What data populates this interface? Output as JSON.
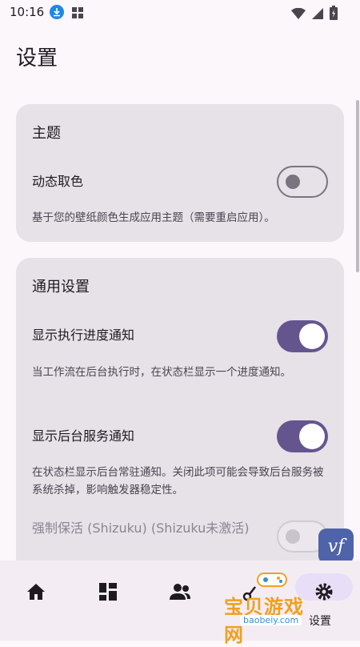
{
  "status": {
    "time": "10:16"
  },
  "page": {
    "title": "设置"
  },
  "theme_card": {
    "title": "主题",
    "dynamic_color_label": "动态取色",
    "dynamic_color_desc": "基于您的壁纸颜色生成应用主题（需要重启应用）。",
    "dynamic_color_on": false
  },
  "general_card": {
    "title": "通用设置",
    "progress_notify_label": "显示执行进度通知",
    "progress_notify_desc": "当工作流在后台执行时，在状态栏显示一个进度通知。",
    "progress_notify_on": true,
    "service_notify_label": "显示后台服务通知",
    "service_notify_desc": "在状态栏显示后台常驻通知。关闭此项可能会导致后台服务被系统杀掉，影响触发器稳定性。",
    "service_notify_on": true,
    "keepalive_label": "强制保活 (Shizuku) (Shizuku未激活)",
    "keepalive_on": false,
    "keepalive_enabled": false
  },
  "bottom_nav": {
    "settings_label": "设置",
    "active_tab": "settings"
  },
  "overlay": {
    "vf_badge": "vf",
    "watermark_text": "宝贝游戏网",
    "watermark_url": "baobeiy.com"
  },
  "colors": {
    "accent": "#65558f",
    "card": "#e7e1e8",
    "background": "#fbf7fb"
  }
}
